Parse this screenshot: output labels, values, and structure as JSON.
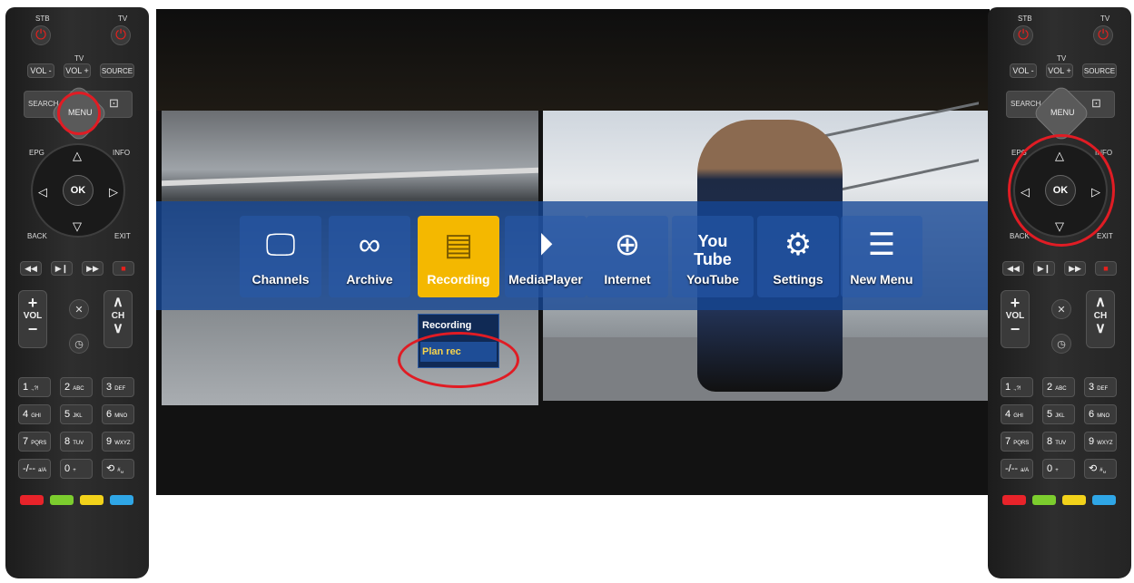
{
  "remote": {
    "stb_label": "STB",
    "tv_label": "TV",
    "tv_group_label": "TV",
    "vol_minus": "VOL -",
    "vol_plus": "VOL +",
    "source": "SOURCE",
    "search": "SEARCH",
    "menu": "MENU",
    "epg": "EPG",
    "info": "INFO",
    "back": "BACK",
    "exit": "EXIT",
    "ok": "OK",
    "vol": "VOL",
    "ch": "CH",
    "numbers": [
      {
        "n": "1",
        "s": ".,?!"
      },
      {
        "n": "2",
        "s": "ABC"
      },
      {
        "n": "3",
        "s": "DEF"
      },
      {
        "n": "4",
        "s": "GHI"
      },
      {
        "n": "5",
        "s": "JKL"
      },
      {
        "n": "6",
        "s": "MNO"
      },
      {
        "n": "7",
        "s": "PQRS"
      },
      {
        "n": "8",
        "s": "TUV"
      },
      {
        "n": "9",
        "s": "WXYZ"
      },
      {
        "n": "-/--",
        "s": "a/A"
      },
      {
        "n": "0",
        "s": "+"
      },
      {
        "n": "⟲",
        "s": "#␣"
      }
    ],
    "color_keys": [
      "#e8232a",
      "#7ccd2e",
      "#f2d21a",
      "#2fa6e6"
    ]
  },
  "tv_menu": {
    "items": [
      {
        "label": "Channels",
        "icon": "tv-icon"
      },
      {
        "label": "Archive",
        "icon": "tape-icon"
      },
      {
        "label": "Recording",
        "icon": "film-icon"
      },
      {
        "label": "MediaPlayer",
        "icon": "play-icon"
      },
      {
        "label": "Internet",
        "icon": "globe-icon"
      },
      {
        "label": "YouTube",
        "icon": "youtube-icon"
      },
      {
        "label": "Settings",
        "icon": "gear-icon"
      },
      {
        "label": "New Menu",
        "icon": "list-icon"
      }
    ],
    "active": "Recording",
    "submenu": [
      "Recording",
      "Plan rec"
    ],
    "submenu_selected": "Plan rec",
    "highlight_color": "#e01c24",
    "active_tile_color": "#f4b800"
  }
}
